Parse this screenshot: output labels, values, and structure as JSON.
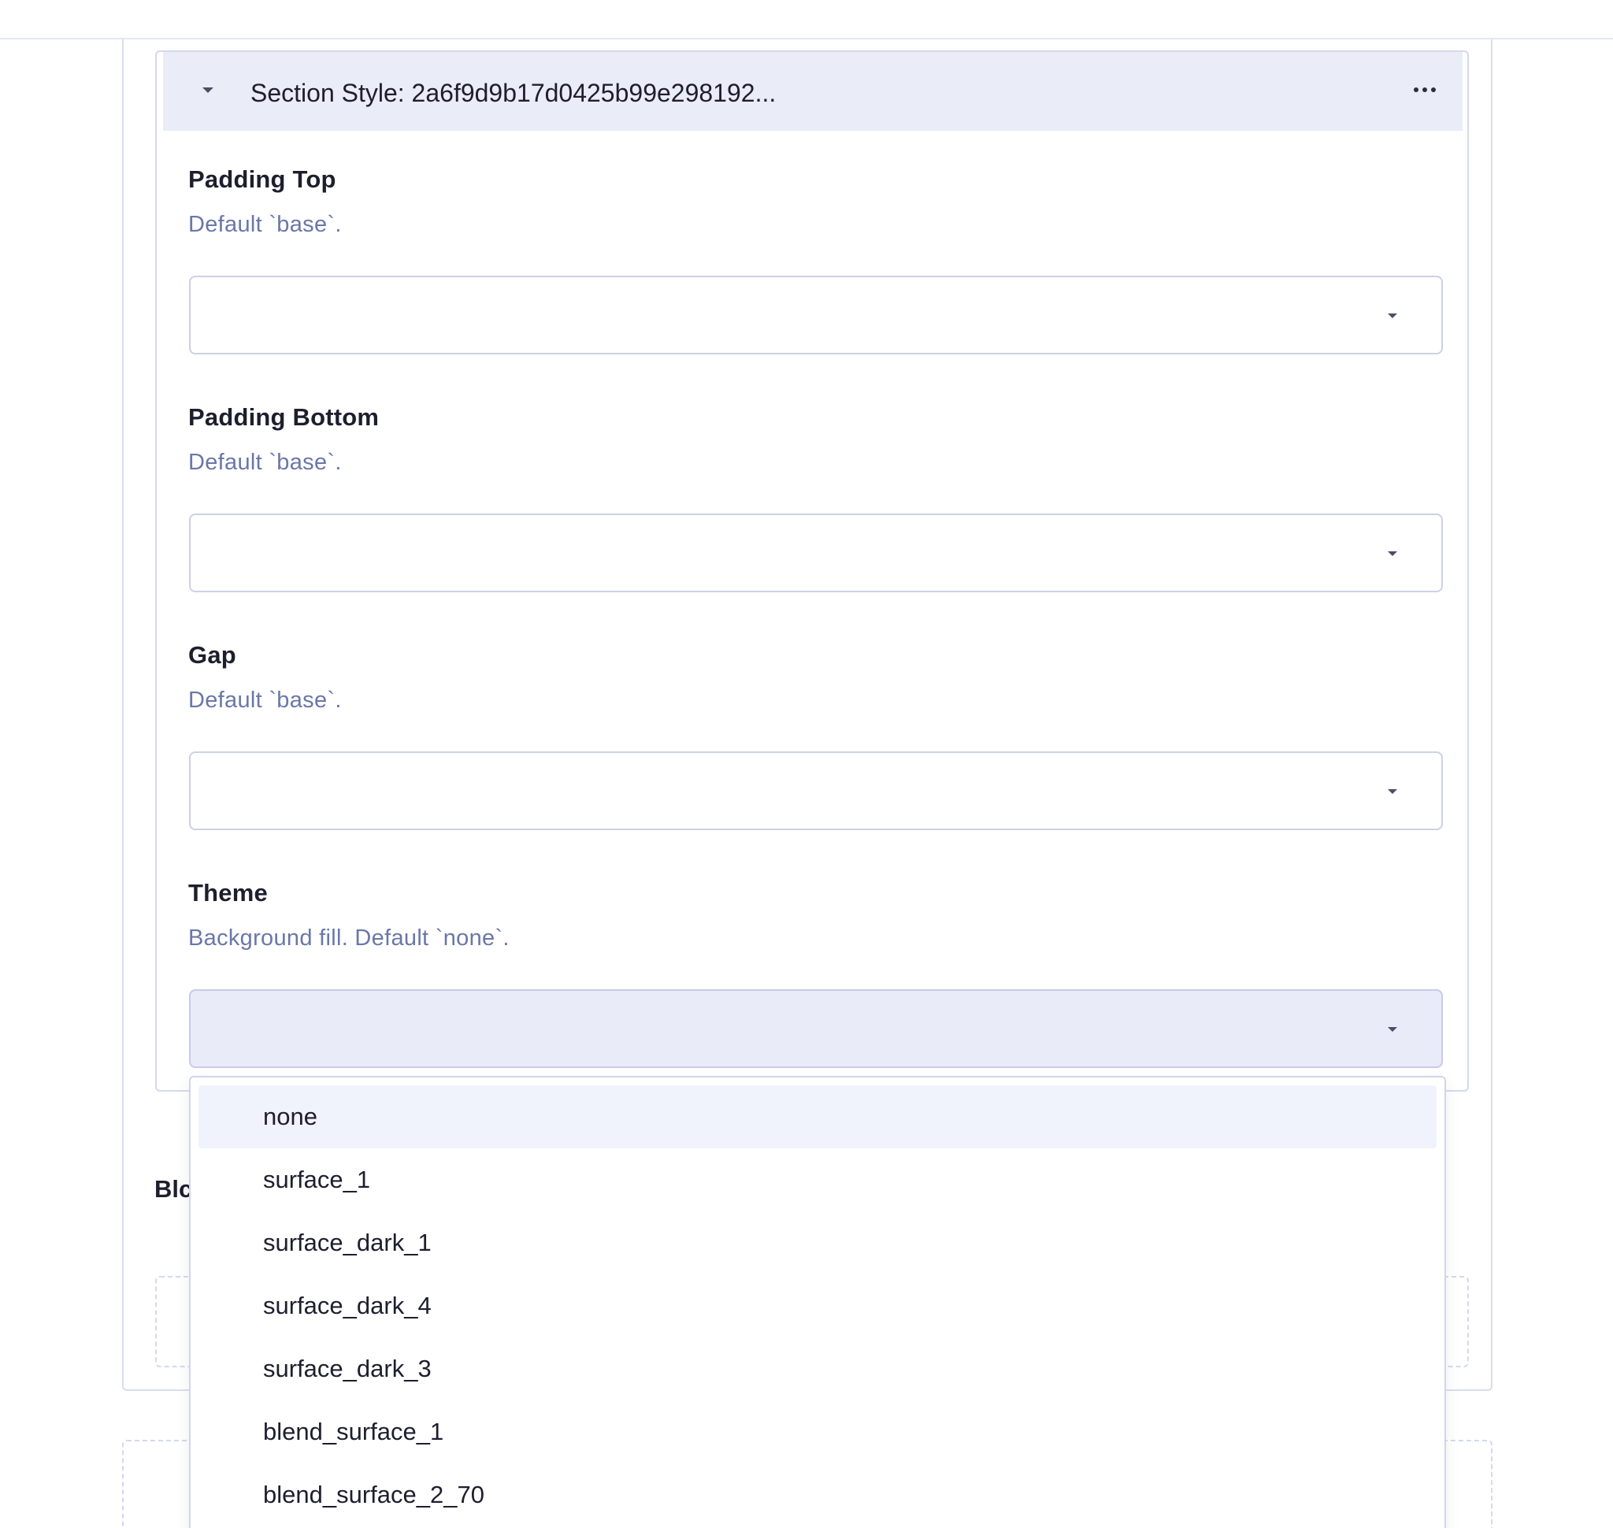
{
  "section": {
    "title": "Section Style: 2a6f9d9b17d0425b99e298192..."
  },
  "fields": {
    "padding_top": {
      "label": "Padding Top",
      "help": "Default `base`.",
      "value": ""
    },
    "padding_bottom": {
      "label": "Padding Bottom",
      "help": "Default `base`.",
      "value": ""
    },
    "gap": {
      "label": "Gap",
      "help": "Default `base`.",
      "value": ""
    },
    "theme": {
      "label": "Theme",
      "help": "Background fill. Default `none`.",
      "value": ""
    }
  },
  "blocks_label": "Blc",
  "dropdown": {
    "options": [
      "none",
      "surface_1",
      "surface_dark_1",
      "surface_dark_4",
      "surface_dark_3",
      "blend_surface_1",
      "blend_surface_2_70"
    ],
    "highlighted_index": 0
  },
  "icons": {
    "collapse": "chevron-down-icon",
    "more": "more-horizontal-icon",
    "select": "chevron-down-icon"
  },
  "colors": {
    "header_bg": "#eaecf8",
    "help_text": "#6a77a8",
    "border": "#d5d8ee",
    "active_select_bg": "#e9ebf8",
    "highlighted_option_bg": "#f1f3fc"
  }
}
